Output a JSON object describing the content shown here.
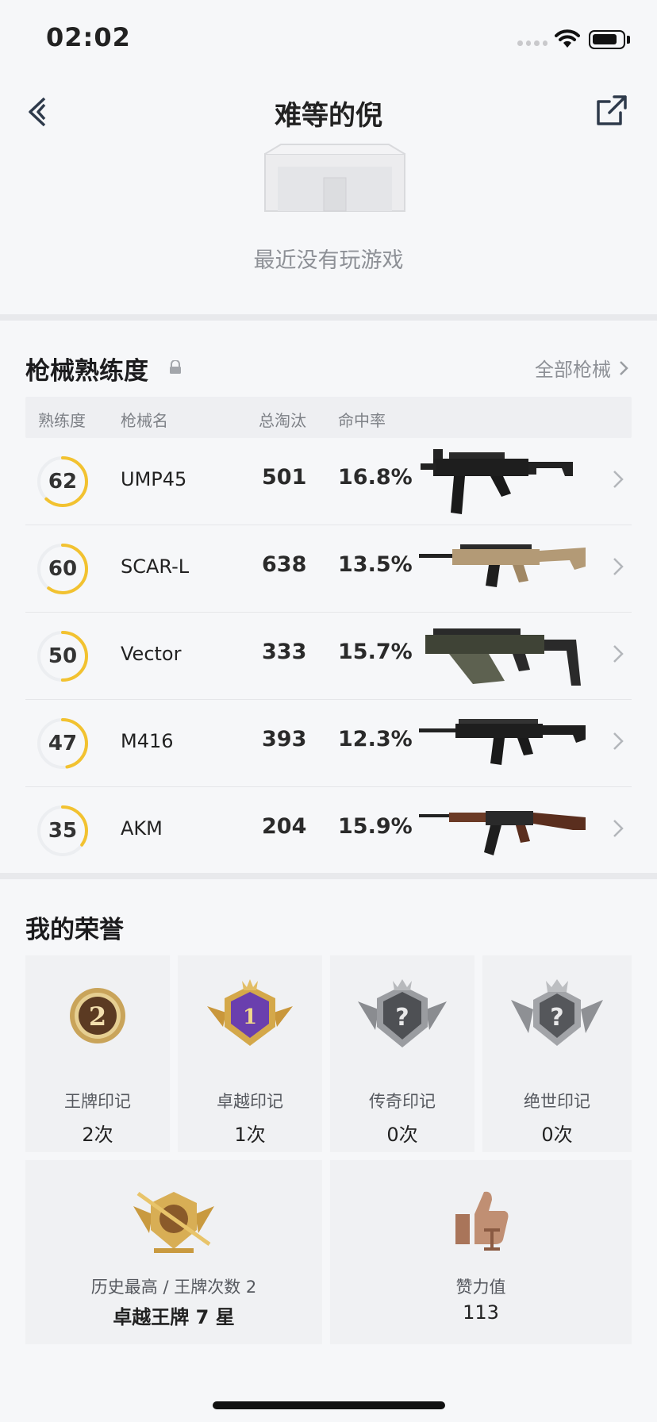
{
  "status": {
    "time": "02:02"
  },
  "header": {
    "title": "难等的倪"
  },
  "recent": {
    "empty_text": "最近没有玩游戏"
  },
  "weapons": {
    "title": "枪械熟练度",
    "all_link": "全部枪械",
    "columns": [
      "熟练度",
      "枪械名",
      "总淘汰",
      "命中率"
    ],
    "rows": [
      {
        "level": "62",
        "name": "UMP45",
        "kills": "501",
        "accuracy": "16.8%",
        "progress": 0.62
      },
      {
        "level": "60",
        "name": "SCAR-L",
        "kills": "638",
        "accuracy": "13.5%",
        "progress": 0.6
      },
      {
        "level": "50",
        "name": "Vector",
        "kills": "333",
        "accuracy": "15.7%",
        "progress": 0.5
      },
      {
        "level": "47",
        "name": "M416",
        "kills": "393",
        "accuracy": "12.3%",
        "progress": 0.47
      },
      {
        "level": "35",
        "name": "AKM",
        "kills": "204",
        "accuracy": "15.9%",
        "progress": 0.35
      }
    ]
  },
  "honors": {
    "title": "我的荣誉",
    "badges": [
      {
        "label": "王牌印记",
        "count": "2次",
        "icon": "ace-badge-icon",
        "digit": "2"
      },
      {
        "label": "卓越印记",
        "count": "1次",
        "icon": "excellence-badge-icon",
        "digit": "1"
      },
      {
        "label": "传奇印记",
        "count": "0次",
        "icon": "legend-badge-icon",
        "digit": "?"
      },
      {
        "label": "绝世印记",
        "count": "0次",
        "icon": "peerless-badge-icon",
        "digit": "?"
      }
    ],
    "highest": {
      "label": "历史最高 / 王牌次数 2",
      "value": "卓越王牌 7 星"
    },
    "likes": {
      "label": "赞力值",
      "value": "113"
    }
  },
  "colors": {
    "accent": "#f2c230",
    "ring_track": "#eceef1",
    "bronze": "#b3836a"
  }
}
